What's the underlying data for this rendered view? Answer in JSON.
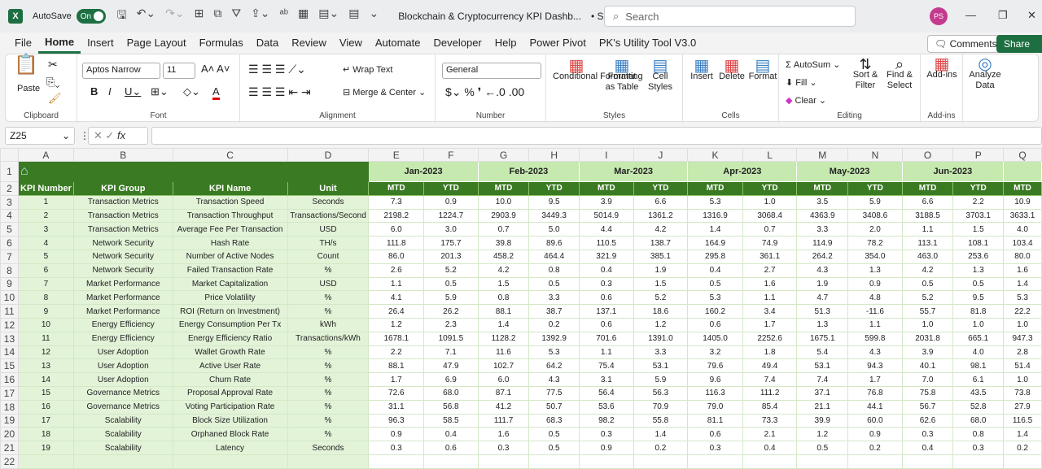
{
  "titlebar": {
    "app_icon": "X",
    "autosave_label": "AutoSave",
    "autosave_state": "On",
    "doc_title": "Blockchain & Cryptocurrency KPI Dashb...",
    "saved": "• Saved ⌵",
    "search_placeholder": "Search",
    "avatar": "PS"
  },
  "tabs": [
    "File",
    "Home",
    "Insert",
    "Page Layout",
    "Formulas",
    "Data",
    "Review",
    "View",
    "Automate",
    "Developer",
    "Help",
    "Power Pivot",
    "PK's Utility Tool V3.0"
  ],
  "header_buttons": {
    "comments": "Comments",
    "share": "Share"
  },
  "ribbon": {
    "clipboard": {
      "label": "Clipboard",
      "paste": "Paste"
    },
    "font": {
      "label": "Font",
      "font_name": "Aptos Narrow",
      "font_size": "11"
    },
    "alignment": {
      "label": "Alignment",
      "wrap": "Wrap Text",
      "merge": "Merge & Center"
    },
    "number": {
      "label": "Number",
      "format": "General"
    },
    "styles": {
      "label": "Styles",
      "conditional": "Conditional Formatting",
      "format_table": "Format as Table",
      "cell_styles": "Cell Styles"
    },
    "cells": {
      "label": "Cells",
      "insert": "Insert",
      "delete": "Delete",
      "format": "Format"
    },
    "editing": {
      "label": "Editing",
      "autosum": "AutoSum",
      "fill": "Fill",
      "clear": "Clear",
      "sort": "Sort & Filter",
      "find": "Find & Select"
    },
    "addins": {
      "label": "Add-ins",
      "addins": "Add-ins"
    },
    "analyze": {
      "label": "Analyze Data"
    }
  },
  "formula_bar": {
    "name_box": "Z25",
    "fx": "fx",
    "value": ""
  },
  "columns": [
    "A",
    "B",
    "C",
    "D",
    "E",
    "F",
    "G",
    "H",
    "I",
    "J",
    "K",
    "L",
    "M",
    "N",
    "O",
    "P",
    "Q"
  ],
  "sheet": {
    "headers": [
      "KPI Number",
      "KPI Group",
      "KPI Name",
      "Unit"
    ],
    "months": [
      "Jan-2023",
      "Feb-2023",
      "Mar-2023",
      "Apr-2023",
      "May-2023",
      "Jun-2023"
    ],
    "sub_headers": [
      "MTD",
      "YTD"
    ],
    "rows": [
      [
        1,
        "Transaction Metrics",
        "Transaction Speed",
        "Seconds",
        "7.3",
        "0.9",
        "10.0",
        "9.5",
        "3.9",
        "6.6",
        "5.3",
        "1.0",
        "3.5",
        "5.9",
        "6.6",
        "2.2",
        "10.9"
      ],
      [
        2,
        "Transaction Metrics",
        "Transaction Throughput",
        "Transactions/Second",
        "2198.2",
        "1224.7",
        "2903.9",
        "3449.3",
        "5014.9",
        "1361.2",
        "1316.9",
        "3068.4",
        "4363.9",
        "3408.6",
        "3188.5",
        "3703.1",
        "3633.1"
      ],
      [
        3,
        "Transaction Metrics",
        "Average Fee Per Transaction",
        "USD",
        "6.0",
        "3.0",
        "0.7",
        "5.0",
        "4.4",
        "4.2",
        "1.4",
        "0.7",
        "3.3",
        "2.0",
        "1.1",
        "1.5",
        "4.0"
      ],
      [
        4,
        "Network Security",
        "Hash Rate",
        "TH/s",
        "111.8",
        "175.7",
        "39.8",
        "89.6",
        "110.5",
        "138.7",
        "164.9",
        "74.9",
        "114.9",
        "78.2",
        "113.1",
        "108.1",
        "103.4"
      ],
      [
        5,
        "Network Security",
        "Number of Active Nodes",
        "Count",
        "86.0",
        "201.3",
        "458.2",
        "464.4",
        "321.9",
        "385.1",
        "295.8",
        "361.1",
        "264.2",
        "354.0",
        "463.0",
        "253.6",
        "80.0"
      ],
      [
        6,
        "Network Security",
        "Failed Transaction Rate",
        "%",
        "2.6",
        "5.2",
        "4.2",
        "0.8",
        "0.4",
        "1.9",
        "0.4",
        "2.7",
        "4.3",
        "1.3",
        "4.2",
        "1.3",
        "1.6"
      ],
      [
        7,
        "Market Performance",
        "Market Capitalization",
        "USD",
        "1.1",
        "0.5",
        "1.5",
        "0.5",
        "0.3",
        "1.5",
        "0.5",
        "1.6",
        "1.9",
        "0.9",
        "0.5",
        "0.5",
        "1.4"
      ],
      [
        8,
        "Market Performance",
        "Price Volatility",
        "%",
        "4.1",
        "5.9",
        "0.8",
        "3.3",
        "0.6",
        "5.2",
        "5.3",
        "1.1",
        "4.7",
        "4.8",
        "5.2",
        "9.5",
        "5.3"
      ],
      [
        9,
        "Market Performance",
        "ROI (Return on Investment)",
        "%",
        "26.4",
        "26.2",
        "88.1",
        "38.7",
        "137.1",
        "18.6",
        "160.2",
        "3.4",
        "51.3",
        "-11.6",
        "55.7",
        "81.8",
        "22.2"
      ],
      [
        10,
        "Energy Efficiency",
        "Energy Consumption Per Tx",
        "kWh",
        "1.2",
        "2.3",
        "1.4",
        "0.2",
        "0.6",
        "1.2",
        "0.6",
        "1.7",
        "1.3",
        "1.1",
        "1.0",
        "1.0",
        "1.0"
      ],
      [
        11,
        "Energy Efficiency",
        "Energy Efficiency Ratio",
        "Transactions/kWh",
        "1678.1",
        "1091.5",
        "1128.2",
        "1392.9",
        "701.6",
        "1391.0",
        "1405.0",
        "2252.6",
        "1675.1",
        "599.8",
        "2031.8",
        "665.1",
        "947.3"
      ],
      [
        12,
        "User Adoption",
        "Wallet Growth Rate",
        "%",
        "2.2",
        "7.1",
        "11.6",
        "5.3",
        "1.1",
        "3.3",
        "3.2",
        "1.8",
        "5.4",
        "4.3",
        "3.9",
        "4.0",
        "2.8"
      ],
      [
        13,
        "User Adoption",
        "Active User Rate",
        "%",
        "88.1",
        "47.9",
        "102.7",
        "64.2",
        "75.4",
        "53.1",
        "79.6",
        "49.4",
        "53.1",
        "94.3",
        "40.1",
        "98.1",
        "51.4"
      ],
      [
        14,
        "User Adoption",
        "Churn Rate",
        "%",
        "1.7",
        "6.9",
        "6.0",
        "4.3",
        "3.1",
        "5.9",
        "9.6",
        "7.4",
        "7.4",
        "1.7",
        "7.0",
        "6.1",
        "1.0"
      ],
      [
        15,
        "Governance Metrics",
        "Proposal Approval Rate",
        "%",
        "72.6",
        "68.0",
        "87.1",
        "77.5",
        "56.4",
        "56.3",
        "116.3",
        "111.2",
        "37.1",
        "76.8",
        "75.8",
        "43.5",
        "73.8"
      ],
      [
        16,
        "Governance Metrics",
        "Voting Participation Rate",
        "%",
        "31.1",
        "56.8",
        "41.2",
        "50.7",
        "53.6",
        "70.9",
        "79.0",
        "85.4",
        "21.1",
        "44.1",
        "56.7",
        "52.8",
        "27.9"
      ],
      [
        17,
        "Scalability",
        "Block Size Utilization",
        "%",
        "96.3",
        "58.5",
        "111.7",
        "68.3",
        "98.2",
        "55.8",
        "81.1",
        "73.3",
        "39.9",
        "60.0",
        "62.6",
        "68.0",
        "116.5"
      ],
      [
        18,
        "Scalability",
        "Orphaned Block Rate",
        "%",
        "0.9",
        "0.4",
        "1.6",
        "0.5",
        "0.3",
        "1.4",
        "0.6",
        "2.1",
        "1.2",
        "0.9",
        "0.3",
        "0.8",
        "1.4"
      ],
      [
        19,
        "Scalability",
        "Latency",
        "Seconds",
        "0.3",
        "0.6",
        "0.3",
        "0.5",
        "0.9",
        "0.2",
        "0.3",
        "0.4",
        "0.5",
        "0.2",
        "0.4",
        "0.3",
        "0.2"
      ]
    ]
  },
  "colors": {
    "excel_green": "#1d6f42",
    "header_green": "#3a7a22",
    "month_fill": "#c6e9b0",
    "left_fill": "#e2f3d8"
  }
}
